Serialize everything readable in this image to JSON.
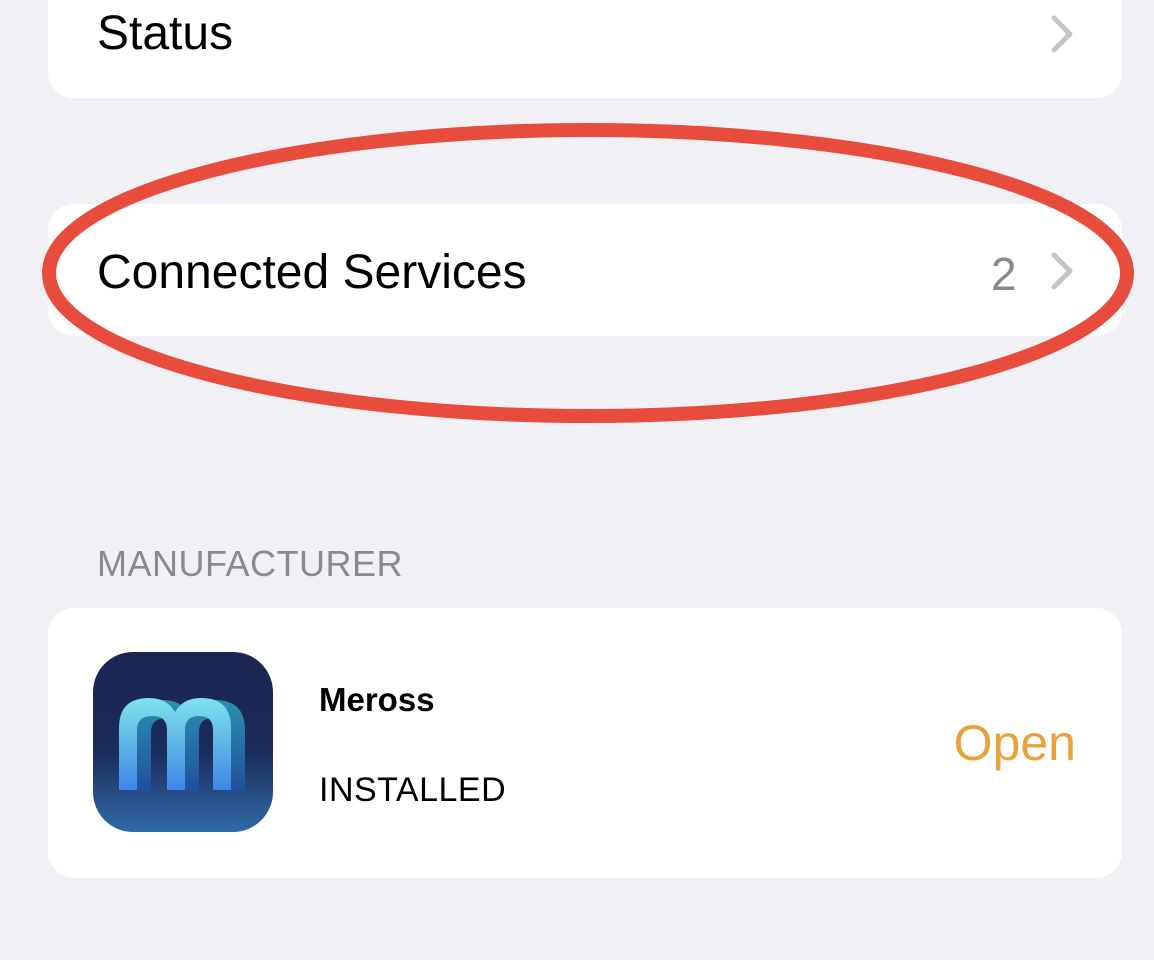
{
  "status_row": {
    "label": "Status",
    "chevron_icon": "chevron-right-icon"
  },
  "connected_services_row": {
    "label": "Connected Services",
    "count": "2",
    "chevron_icon": "chevron-right-icon"
  },
  "annotation": {
    "type": "highlight-ellipse",
    "color": "#e84c3d"
  },
  "manufacturer_section": {
    "header": "MANUFACTURER",
    "app": {
      "name": "Meross",
      "status": "INSTALLED",
      "icon": "meross-app-icon",
      "action_label": "Open"
    }
  },
  "colors": {
    "background": "#f1f0f5",
    "card": "#ffffff",
    "secondary_text": "#8a8a8e",
    "accent": "#e9a23b"
  }
}
